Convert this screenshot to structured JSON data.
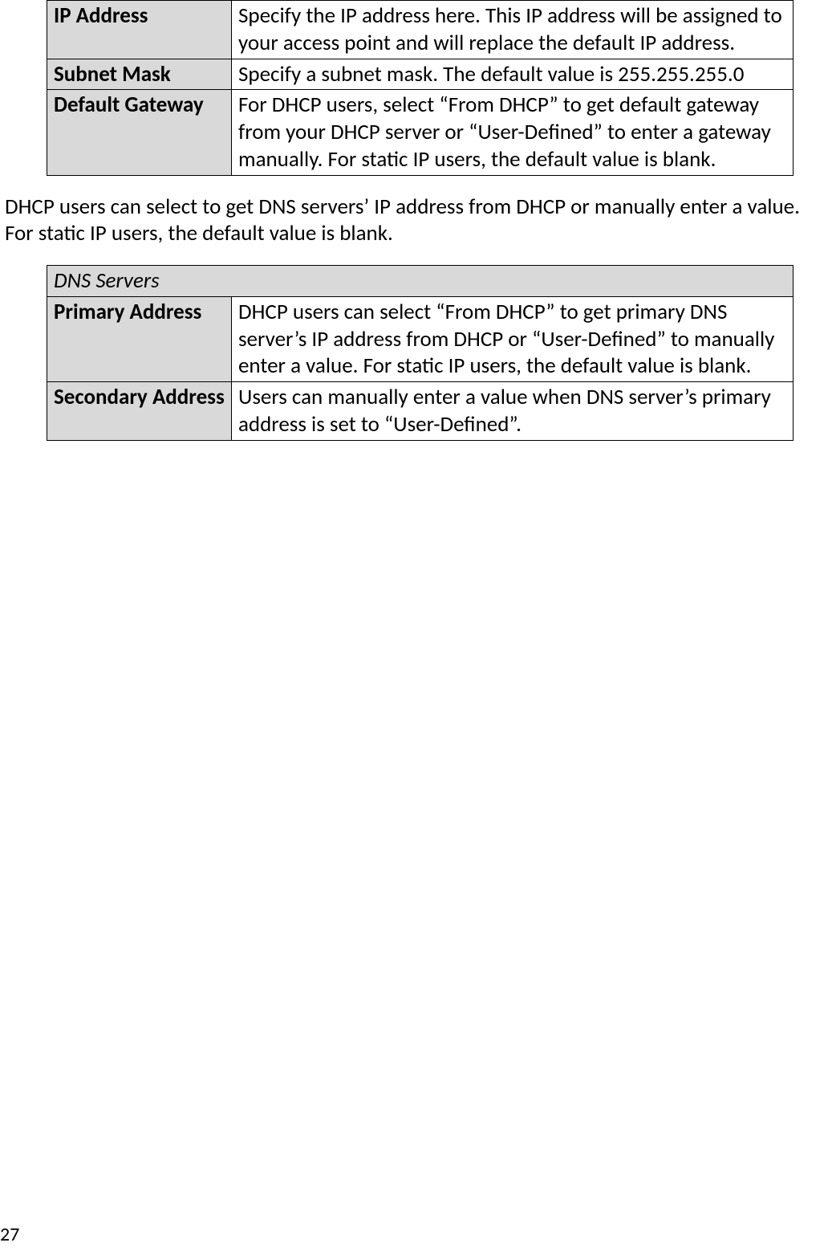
{
  "table1": {
    "rows": [
      {
        "label": "IP Address",
        "desc": "Specify the IP address here. This IP address will be assigned to your access point and will replace the default IP address."
      },
      {
        "label": "Subnet Mask",
        "desc": "Specify a subnet mask. The default value is 255.255.255.0"
      },
      {
        "label": "Default Gateway",
        "desc": "For DHCP users, select “From DHCP” to get default gateway from your DHCP server or “User-Defined” to enter a gateway manually. For static IP users, the default value is blank."
      }
    ]
  },
  "paragraph1": "DHCP users can select to get DNS servers’ IP address from DHCP or manually enter a value. For static IP users, the default value is blank.",
  "table2": {
    "header": "DNS Servers",
    "rows": [
      {
        "label": "Primary Address",
        "desc": "DHCP users can select “From DHCP” to get primary DNS server’s IP address from DHCP or “User-Defined” to manually enter a value. For static IP users, the default value is blank."
      },
      {
        "label": "Secondary Address",
        "desc": "Users can manually enter a value when DNS server’s primary address is set to “User-Defined”."
      }
    ]
  },
  "page_number": "27"
}
